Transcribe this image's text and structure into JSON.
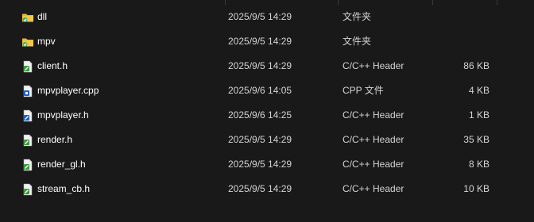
{
  "files": [
    {
      "name": "dll",
      "modified": "2025/9/5 14:29",
      "type": "文件夹",
      "size": "",
      "icon": "folder-icon"
    },
    {
      "name": "mpv",
      "modified": "2025/9/5 14:29",
      "type": "文件夹",
      "size": "",
      "icon": "folder-icon"
    },
    {
      "name": "client.h",
      "modified": "2025/9/5 14:29",
      "type": "C/C++ Header",
      "size": "86 KB",
      "icon": "header-file-icon"
    },
    {
      "name": "mpvplayer.cpp",
      "modified": "2025/9/6 14:05",
      "type": "CPP 文件",
      "size": "4 KB",
      "icon": "cpp-file-icon"
    },
    {
      "name": "mpvplayer.h",
      "modified": "2025/9/6 14:25",
      "type": "C/C++ Header",
      "size": "1 KB",
      "icon": "header-file-blue-icon"
    },
    {
      "name": "render.h",
      "modified": "2025/9/5 14:29",
      "type": "C/C++ Header",
      "size": "35 KB",
      "icon": "header-file-icon"
    },
    {
      "name": "render_gl.h",
      "modified": "2025/9/5 14:29",
      "type": "C/C++ Header",
      "size": "8 KB",
      "icon": "header-file-icon"
    },
    {
      "name": "stream_cb.h",
      "modified": "2025/9/5 14:29",
      "type": "C/C++ Header",
      "size": "10 KB",
      "icon": "header-file-icon"
    }
  ],
  "colors": {
    "background": "#191919",
    "folder": "#e8b630",
    "folder_badge": "#3cb054",
    "header_icon_accent": "#3a9a3a",
    "cpp_icon_accent": "#1f5fc4"
  }
}
